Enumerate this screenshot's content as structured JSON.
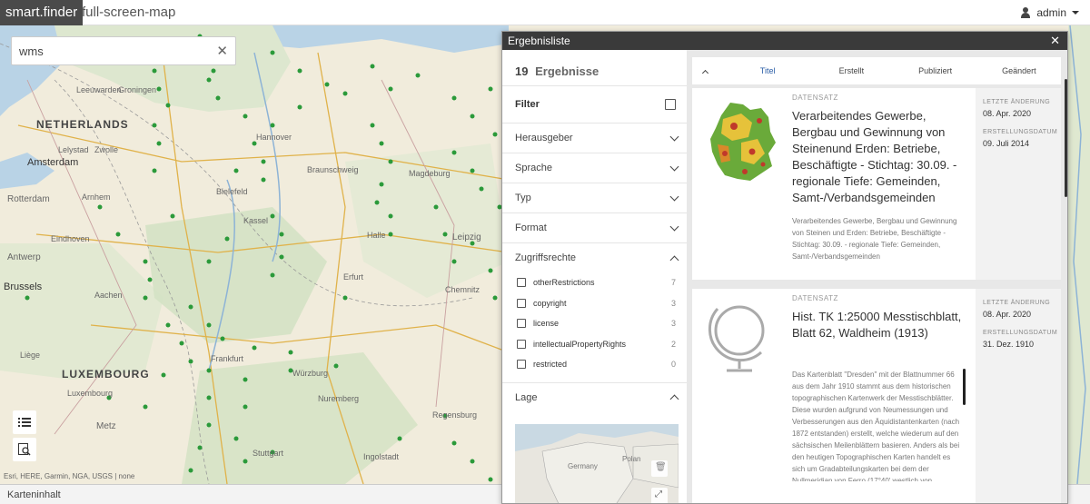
{
  "header": {
    "brand": "smart.finder",
    "breadcrumb": "full-screen-map",
    "user": "admin"
  },
  "search": {
    "value": "wms",
    "clear_icon": "close-icon"
  },
  "map": {
    "countries": [
      "NETHERLANDS",
      "LUXEMBOURG"
    ],
    "labels": [
      "Amsterdam",
      "Leeuwarden",
      "Groningen",
      "Lelystad",
      "Zwolle",
      "Rotterdam",
      "Arnhem",
      "Eindhoven",
      "Antwerp",
      "Brussels",
      "Liège",
      "Aachen",
      "Bielefeld",
      "Hannover",
      "Braunschweig",
      "Magdeburg",
      "Halle",
      "Leipzig",
      "Erfurt",
      "Chemnitz",
      "Kassel",
      "Frankfurt",
      "Nuremberg",
      "Stuttgart",
      "Würzburg",
      "Metz",
      "Luxembourg",
      "Ingolstadt",
      "Regensburg"
    ],
    "attribution": "Esri, HERE, Garmin, NGA, USGS | none"
  },
  "bottombar": {
    "label": "Karteninhalt"
  },
  "panel": {
    "title": "Ergebnisliste",
    "count": "19",
    "count_label": "Ergebnisse",
    "filter_title": "Filter",
    "facets": [
      {
        "label": "Herausgeber",
        "expanded": false
      },
      {
        "label": "Sprache",
        "expanded": false
      },
      {
        "label": "Typ",
        "expanded": false
      },
      {
        "label": "Format",
        "expanded": false
      },
      {
        "label": "Zugriffsrechte",
        "expanded": true
      }
    ],
    "access_options": [
      {
        "label": "otherRestrictions",
        "count": "7"
      },
      {
        "label": "copyright",
        "count": "3"
      },
      {
        "label": "license",
        "count": "3"
      },
      {
        "label": "intellectualPropertyRights",
        "count": "2"
      },
      {
        "label": "restricted",
        "count": "0"
      }
    ],
    "lage_label": "Lage",
    "minimap_labels": [
      "Germany",
      "Polan"
    ],
    "sort": [
      "Titel",
      "Erstellt",
      "Publiziert",
      "Geändert"
    ],
    "results": [
      {
        "type": "DATENSATZ",
        "title": "Verarbeitendes Gewerbe, Bergbau und Gewinnung von Steinenund Erden: Betriebe, Beschäftigte - Stichtag: 30.09. - regionale Tiefe: Gemeinden, Samt-/Verbandsgemeinden",
        "description": "Verarbeitendes Gewerbe, Bergbau und Gewinnung von Steinen und Erden: Betriebe, Beschäftigte - Stichtag: 30.09. - regionale Tiefe: Gemeinden, Samt-/Verbandsgemeinden",
        "changed_label": "LETZTE ÄNDERUNG",
        "changed": "08. Apr. 2020",
        "created_label": "ERSTELLUNGSDATUM",
        "created": "09. Juli 2014"
      },
      {
        "type": "DATENSATZ",
        "title": "Hist. TK 1:25000 Messtischblatt, Blatt 62, Waldheim (1913)",
        "description": "Das Kartenblatt \"Dresden\" mit der Blattnummer 66 aus dem Jahr 1910 stammt aus dem historischen topographischen Kartenwerk der Messtischblätter. Diese wurden aufgrund von Neumessungen und Verbesserungen aus den Äquidistantenkarten (nach 1872 entstanden) erstellt, welche wiederum auf den sächsischen Meilenblättern basieren. Anders als bei den heutigen Topographischen Karten handelt es sich um Gradabteilungskarten bei dem der Nullmeridian von Ferro (17°40' westlich von",
        "changed_label": "LETZTE ÄNDERUNG",
        "changed": "08. Apr. 2020",
        "created_label": "ERSTELLUNGSDATUM",
        "created": "31. Dez. 1910"
      }
    ]
  }
}
